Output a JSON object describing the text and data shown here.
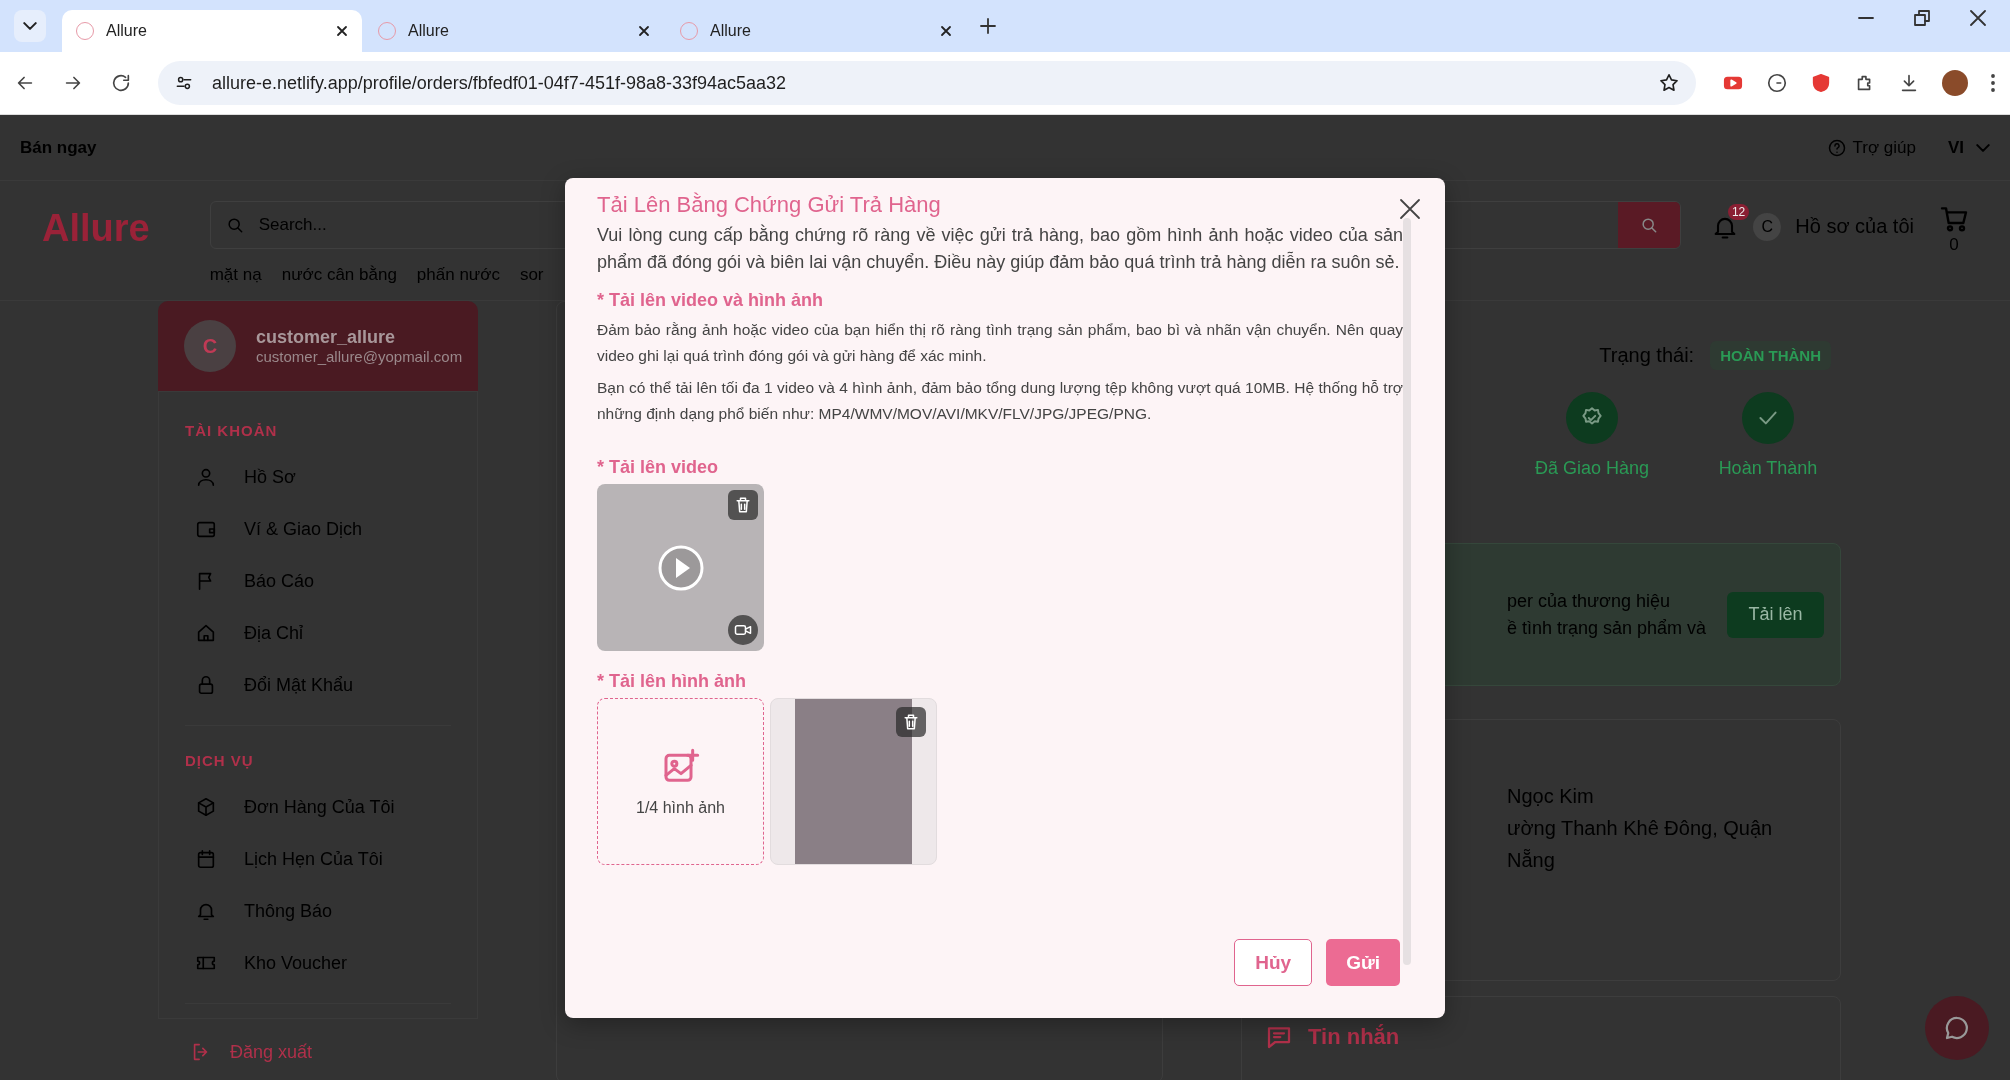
{
  "browser": {
    "tabs": [
      {
        "title": "Allure",
        "selected": true
      },
      {
        "title": "Allure",
        "selected": false
      },
      {
        "title": "Allure",
        "selected": false
      }
    ],
    "url": "allure-e.netlify.app/profile/orders/fbfedf01-04f7-451f-98a8-33f94ac5aa32"
  },
  "topbar": {
    "sell": "Bán ngay",
    "help": "Trợ giúp",
    "language": "VI"
  },
  "header": {
    "logo": "Allure",
    "search_placeholder": "Search...",
    "categories": [
      "mặt nạ",
      "nước cân bằng",
      "phấn nước",
      "sor"
    ],
    "notification_count": "12",
    "avatar_letter": "C",
    "profile": "Hồ sơ của tôi",
    "cart_count": "0"
  },
  "sidebar": {
    "avatar_letter": "C",
    "username": "customer_allure",
    "email": "customer_allure@yopmail.com",
    "sections": [
      {
        "title": "TÀI KHOẢN",
        "items": [
          "Hồ Sơ",
          "Ví & Giao Dịch",
          "Báo Cáo",
          "Địa Chỉ",
          "Đổi Mật Khẩu"
        ]
      },
      {
        "title": "DỊCH VỤ",
        "items": [
          "Đơn Hàng Của Tôi",
          "Lịch Hẹn Của Tôi",
          "Thông Báo",
          "Kho Voucher"
        ]
      }
    ],
    "logout": "Đăng xuất"
  },
  "order": {
    "status_label": "Trạng thái:",
    "status": "HOÀN THÀNH",
    "steps": [
      "Đã Giao Hàng",
      "Hoàn Thành"
    ],
    "notice_lines": [
      "per của thương hiệu",
      "ề tình trạng sản phẩm và"
    ],
    "upload_button": "Tải lên",
    "address_lines": [
      "Ngọc Kim",
      "ường Thanh Khê Đông, Quận",
      "Nẵng"
    ],
    "messages": "Tin nhắn"
  },
  "modal": {
    "title": "Tải Lên Bằng Chứng Gửi Trả Hàng",
    "intro": "Vui lòng cung cấp bằng chứng rõ ràng về việc gửi trả hàng, bao gồm hình ảnh hoặc video của sản phẩm đã đóng gói và biên lai vận chuyển. Điều này giúp đảm bảo quá trình trả hàng diễn ra suôn sẻ.",
    "section_label": "* Tải lên video và hình ảnh",
    "notes": [
      "Đảm bảo rằng ảnh hoặc video của bạn hiển thị rõ ràng tình trạng sản phẩm, bao bì và nhãn vận chuyển. Nên quay video ghi lại quá trình đóng gói và gửi hàng để xác minh.",
      "Bạn có thể tải lên tối đa 1 video và 4 hình ảnh, đảm bảo tổng dung lượng tệp không vượt quá 10MB. Hệ thống hỗ trợ những định dạng phổ biến như: MP4/WMV/MOV/AVI/MKV/FLV/JPG/JPEG/PNG."
    ],
    "video_label": "* Tải lên video",
    "image_label": "* Tải lên hình ảnh",
    "image_counter": "1/4 hình ảnh",
    "cancel": "Hủy",
    "submit": "Gửi"
  }
}
